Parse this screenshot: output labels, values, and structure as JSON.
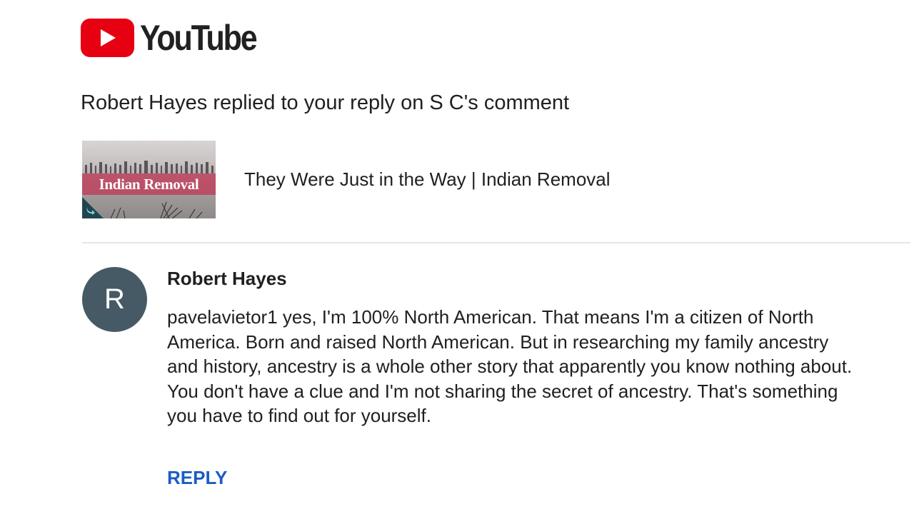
{
  "brand": {
    "name": "YouTube",
    "icon": "play-icon",
    "red": "#e60012"
  },
  "notification": {
    "headline": "Robert Hayes replied to your reply on S C's comment"
  },
  "video": {
    "thumbnail_caption": "Indian Removal",
    "title": "They Were Just in the Way | Indian Removal",
    "badge_icon": "arrow-icon"
  },
  "comment": {
    "avatar_initial": "R",
    "avatar_color": "#455a64",
    "author": "Robert Hayes",
    "text_lines": [
      "pavelavietor1 yes, I'm 100% North American. That means I'm a citizen of North",
      "America. Born and raised North American. But in researching my family ancestry",
      "and history, ancestry is a whole other story that apparently you know nothing about.",
      "You don't have a clue and I'm not sharing the secret of ancestry. That's something",
      "you have to find out for yourself."
    ]
  },
  "actions": {
    "reply_label": "REPLY",
    "reply_color": "#1a5dc2"
  }
}
